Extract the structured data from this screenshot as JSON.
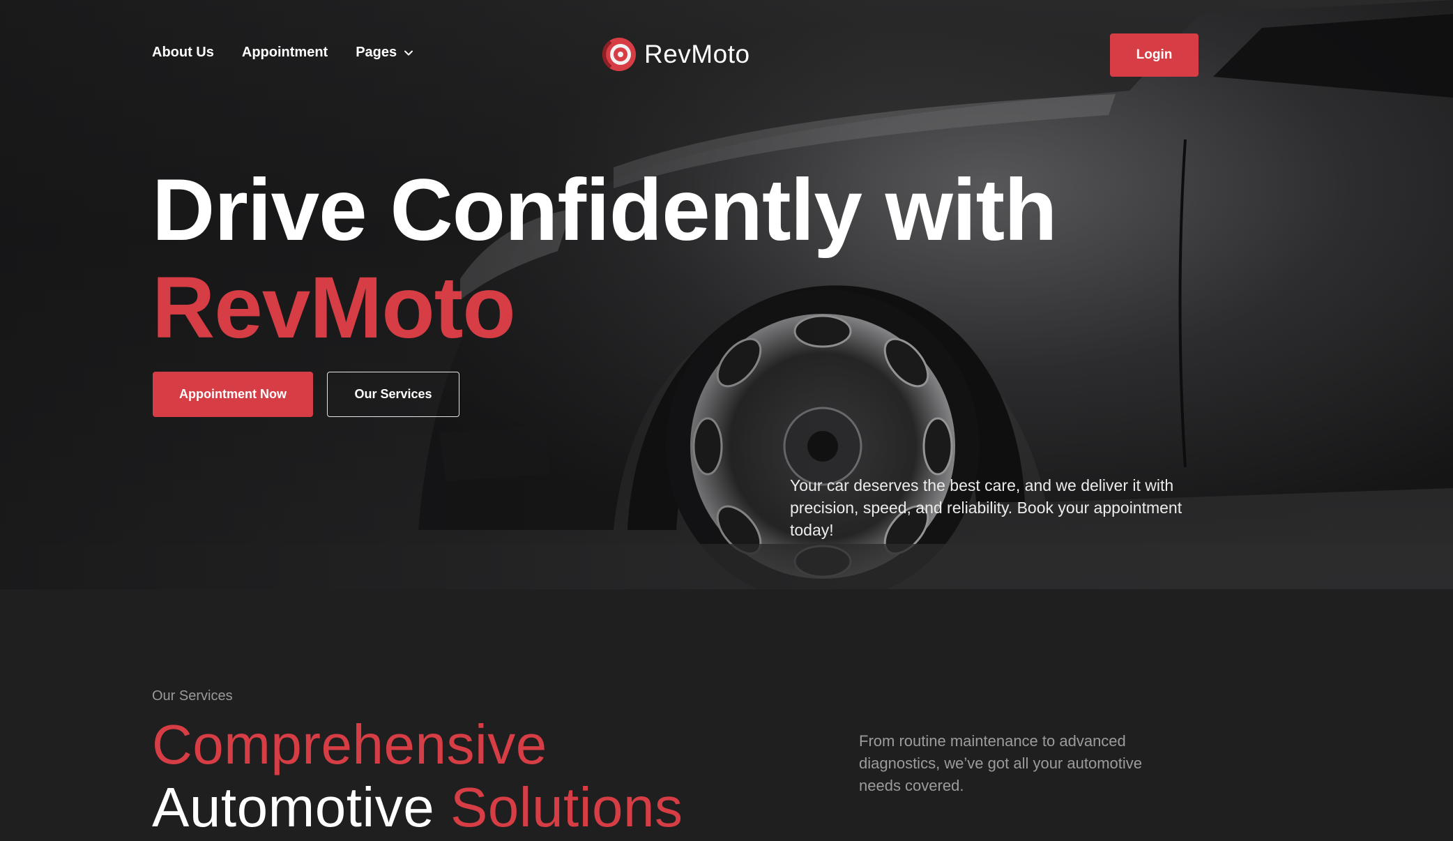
{
  "brand": {
    "name": "RevMoto",
    "accent": "#d63d44"
  },
  "nav": {
    "items": [
      {
        "label": "About Us"
      },
      {
        "label": "Appointment"
      },
      {
        "label": "Pages"
      }
    ],
    "login_label": "Login"
  },
  "hero": {
    "title_line1": "Drive Confidently with",
    "title_line2": "RevMoto",
    "primary_cta": "Appointment Now",
    "secondary_cta": "Our Services",
    "description": "Your car deserves the best care, and we deliver it with precision, speed, and reliability. Book your appointment today!"
  },
  "services": {
    "eyebrow": "Our Services",
    "title_word1": "Comprehensive",
    "title_word2": "Automotive",
    "title_word3": "Solutions",
    "description": "From routine maintenance to advanced diagnostics, we’ve got all your automotive needs covered."
  },
  "icons": {
    "logo": "brake-disc-icon",
    "pages_dropdown": "chevron-down-icon"
  }
}
